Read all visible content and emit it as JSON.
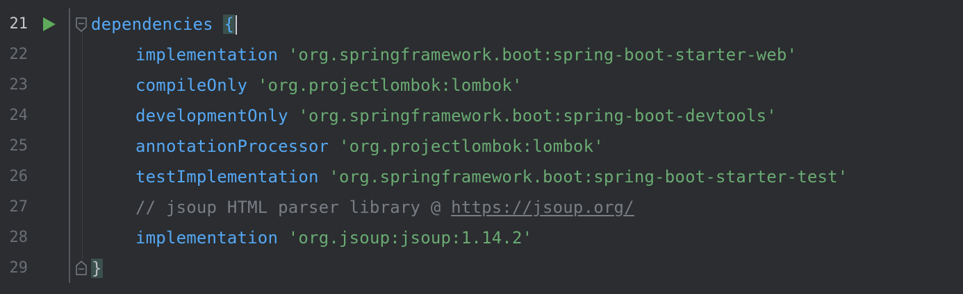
{
  "editor": {
    "lines": [
      {
        "number": "21",
        "current": true,
        "tokens": [
          {
            "t": "kw",
            "v": "dependencies"
          },
          {
            "t": "plain",
            "v": " "
          },
          {
            "t": "brace-open",
            "v": "{"
          }
        ],
        "indent": false,
        "run": true,
        "fold": "open"
      },
      {
        "number": "22",
        "current": false,
        "tokens": [
          {
            "t": "kw",
            "v": "implementation"
          },
          {
            "t": "plain",
            "v": " "
          },
          {
            "t": "str",
            "v": "'org.springframework.boot:spring-boot-starter-web'"
          }
        ],
        "indent": true
      },
      {
        "number": "23",
        "current": false,
        "tokens": [
          {
            "t": "kw",
            "v": "compileOnly"
          },
          {
            "t": "plain",
            "v": " "
          },
          {
            "t": "str",
            "v": "'org.projectlombok:lombok'"
          }
        ],
        "indent": true
      },
      {
        "number": "24",
        "current": false,
        "tokens": [
          {
            "t": "kw",
            "v": "developmentOnly"
          },
          {
            "t": "plain",
            "v": " "
          },
          {
            "t": "str",
            "v": "'org.springframework.boot:spring-boot-devtools'"
          }
        ],
        "indent": true
      },
      {
        "number": "25",
        "current": false,
        "tokens": [
          {
            "t": "kw",
            "v": "annotationProcessor"
          },
          {
            "t": "plain",
            "v": " "
          },
          {
            "t": "str",
            "v": "'org.projectlombok:lombok'"
          }
        ],
        "indent": true
      },
      {
        "number": "26",
        "current": false,
        "tokens": [
          {
            "t": "kw",
            "v": "testImplementation"
          },
          {
            "t": "plain",
            "v": " "
          },
          {
            "t": "str",
            "v": "'org.springframework.boot:spring-boot-starter-test'"
          }
        ],
        "indent": true
      },
      {
        "number": "27",
        "current": false,
        "tokens": [
          {
            "t": "cmt",
            "v": "// jsoup HTML parser library @ "
          },
          {
            "t": "url",
            "v": "https://jsoup.org/"
          }
        ],
        "indent": true
      },
      {
        "number": "28",
        "current": false,
        "tokens": [
          {
            "t": "kw",
            "v": "implementation"
          },
          {
            "t": "plain",
            "v": " "
          },
          {
            "t": "str",
            "v": "'org.jsoup:jsoup:1.14.2'"
          }
        ],
        "indent": true
      },
      {
        "number": "29",
        "current": false,
        "tokens": [
          {
            "t": "brace-close",
            "v": "}"
          }
        ],
        "indent": false,
        "fold": "close"
      }
    ]
  },
  "colors": {
    "background": "#2b2d30",
    "keyword": "#56a8f5",
    "string": "#6aab73",
    "comment": "#7a7e85",
    "run_icon": "#5faa5c"
  },
  "icons": {
    "run": "run-gutter-icon",
    "fold_open": "fold-open-icon",
    "fold_close": "fold-close-icon"
  }
}
